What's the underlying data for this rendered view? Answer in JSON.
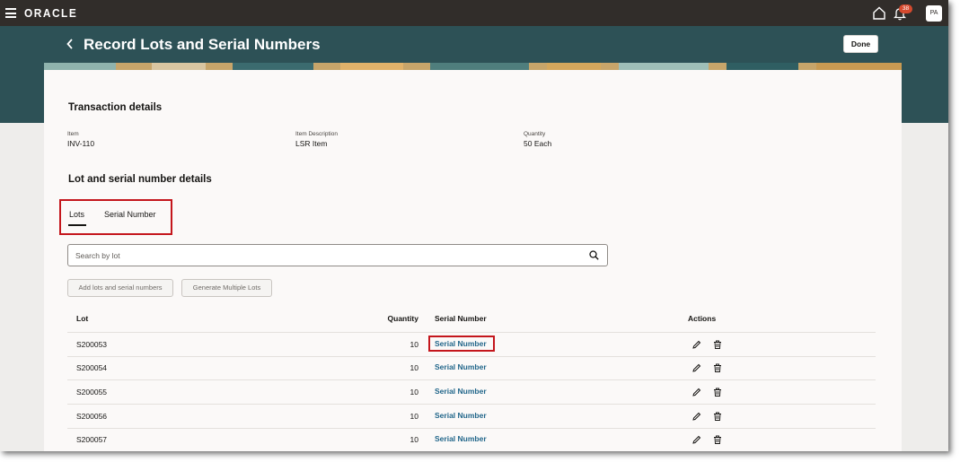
{
  "app": {
    "logo": "ORACLE",
    "notification_count": "38",
    "avatar_initials": "PA"
  },
  "header": {
    "title": "Record Lots and Serial Numbers",
    "done_label": "Done"
  },
  "transaction": {
    "title": "Transaction details",
    "fields": [
      {
        "label": "Item",
        "value": "INV-110"
      },
      {
        "label": "Item Description",
        "value": "LSR Item"
      },
      {
        "label": "Quantity",
        "value": "50 Each"
      }
    ]
  },
  "lot_section": {
    "title": "Lot and serial number details",
    "tabs": [
      {
        "label": "Lots",
        "selected": true
      },
      {
        "label": "Serial Number",
        "selected": false
      }
    ],
    "search": {
      "placeholder": "Search by lot",
      "value": ""
    },
    "buttons": {
      "add_label": "Add lots and serial numbers",
      "generate_label": "Generate Multiple Lots"
    }
  },
  "table": {
    "columns": [
      "Lot",
      "Quantity",
      "Serial Number",
      "Actions"
    ],
    "rows": [
      {
        "lot": "S200053",
        "quantity": "10",
        "serial": "Serial Number"
      },
      {
        "lot": "S200054",
        "quantity": "10",
        "serial": "Serial Number"
      },
      {
        "lot": "S200055",
        "quantity": "10",
        "serial": "Serial Number"
      },
      {
        "lot": "S200056",
        "quantity": "10",
        "serial": "Serial Number"
      },
      {
        "lot": "S200057",
        "quantity": "10",
        "serial": "Serial Number"
      }
    ]
  },
  "icons": {
    "menu": "hamburger-menu-icon",
    "home": "home-icon",
    "notifications": "bell-icon",
    "back": "chevron-left-icon",
    "search": "search-icon",
    "edit": "pencil-icon",
    "delete": "trash-icon"
  },
  "colors": {
    "topbar": "#312d2a",
    "header": "#2d5156",
    "link": "#21668a",
    "highlight": "#c4161c",
    "badge": "#d64a2e"
  }
}
